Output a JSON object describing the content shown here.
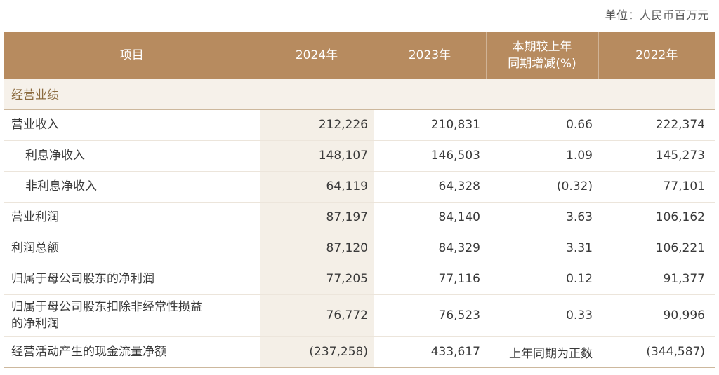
{
  "unit": "单位：人民币百万元",
  "headers": {
    "item": "项目",
    "y2024": "2024年",
    "y2023": "2023年",
    "change_line1": "本期较上年",
    "change_line2": "同期增减(%)",
    "y2022": "2022年"
  },
  "section": "经营业绩",
  "rows": [
    {
      "label": "营业收入",
      "y2024": "212,226",
      "y2023": "210,831",
      "change": "0.66",
      "y2022": "222,374"
    },
    {
      "label": "利息净收入",
      "y2024": "148,107",
      "y2023": "146,503",
      "change": "1.09",
      "y2022": "145,273"
    },
    {
      "label": "非利息净收入",
      "y2024": "64,119",
      "y2023": "64,328",
      "change": "(0.32)",
      "y2022": "77,101"
    },
    {
      "label": "营业利润",
      "y2024": "87,197",
      "y2023": "84,140",
      "change": "3.63",
      "y2022": "106,162"
    },
    {
      "label": "利润总额",
      "y2024": "87,120",
      "y2023": "84,329",
      "change": "3.31",
      "y2022": "106,221"
    },
    {
      "label": "归属于母公司股东的净利润",
      "y2024": "77,205",
      "y2023": "77,116",
      "change": "0.12",
      "y2022": "91,377"
    },
    {
      "label_line1": "归属于母公司股东扣除非经常性损益",
      "label_line2": "的净利润",
      "y2024": "76,772",
      "y2023": "76,523",
      "change": "0.33",
      "y2022": "90,996"
    },
    {
      "label": "经营活动产生的现金流量净额",
      "y2024": "(237,258)",
      "y2023": "433,617",
      "change": "上年同期为正数",
      "y2022": "(344,587)"
    }
  ]
}
